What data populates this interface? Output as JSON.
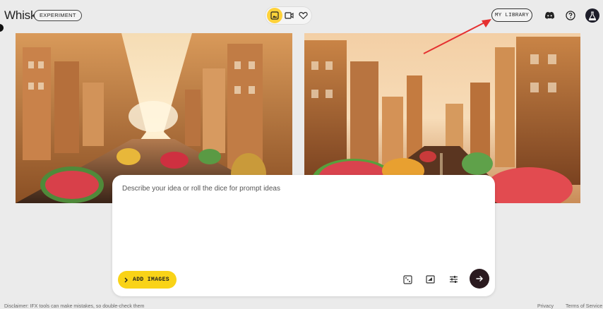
{
  "header": {
    "app_name": "Whisk",
    "badge": "EXPERIMENT",
    "library_button": "MY LIBRARY",
    "mode_icons": [
      "image-mode-icon",
      "video-mode-icon",
      "favorites-icon"
    ],
    "right_icons": [
      "discord-icon",
      "help-icon",
      "labs-avatar-icon"
    ]
  },
  "gallery": {
    "images": [
      "pastry-city-street-scene-left",
      "pastry-city-street-scene-right"
    ]
  },
  "prompt": {
    "placeholder": "Describe your idea or roll the dice for prompt ideas",
    "add_images_label": "ADD IMAGES",
    "tools": [
      "dice-icon",
      "aspect-ratio-icon",
      "settings-sliders-icon"
    ],
    "submit_icon": "arrow-right-icon"
  },
  "footer": {
    "disclaimer": "Disclaimer: IFX tools can make mistakes, so double-check them",
    "privacy": "Privacy",
    "terms": "Terms of Service"
  },
  "colors": {
    "accent": "#f9d317",
    "background": "#ebebeb",
    "submit": "#2a1a1f",
    "annotation_arrow": "#e53030"
  }
}
